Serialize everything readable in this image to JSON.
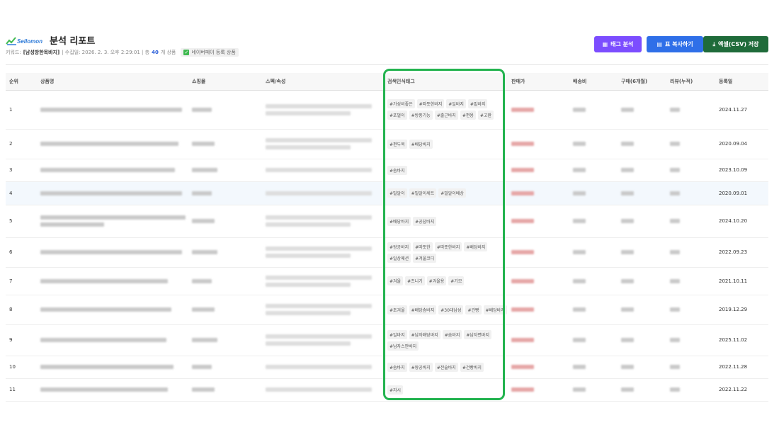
{
  "header": {
    "logo_text": "Sellomon",
    "title": "분석 리포트",
    "meta_prefix": "키워드:",
    "keyword": "[남성방한목바지]",
    "meta_collected": "| 수집일: 2026. 2. 3. 오후 2:29:01 | 총",
    "product_count": "40",
    "meta_suffix": "개 상품",
    "naverpay_badge": "네이버페이 등록 상품"
  },
  "toolbar": {
    "tag_analysis_label": "태그 분석",
    "copy_table_label": "표 복사하기",
    "excel_label": "엑셀(CSV) 저장"
  },
  "table": {
    "headers": [
      "순위",
      "상품명",
      "쇼핑몰",
      "스펙/속성",
      "검색인식태그",
      "판매가",
      "배송비",
      "구매(6개월)",
      "리뷰(누적)",
      "등록일"
    ],
    "rows": [
      {
        "rank": "1",
        "tags": [
          "#가성비좋은",
          "#따뜻한바지",
          "#일바지",
          "#밑바지",
          "#포멀이",
          "#방풍기능",
          "#출근바지",
          "#편용",
          "#고환"
        ],
        "date": "2024.11.27"
      },
      {
        "rank": "2",
        "tags": [
          "#편두복",
          "#배당바지"
        ],
        "date": "2020.09.04"
      },
      {
        "rank": "3",
        "tags": [
          "#솜바지"
        ],
        "date": "2023.10.09"
      },
      {
        "rank": "4",
        "tags": [
          "#밀알이",
          "#밀알이세트",
          "#밀알이배상"
        ],
        "date": "2020.09.01"
      },
      {
        "rank": "5",
        "tags": [
          "#배당바지",
          "#공답바지"
        ],
        "date": "2024.10.20"
      },
      {
        "rank": "6",
        "tags": [
          "#왕공바지",
          "#따뜻한",
          "#따뜻한바지",
          "#배당바지",
          "#일상패션",
          "#겨울코디"
        ],
        "date": "2022.09.23"
      },
      {
        "rank": "7",
        "tags": [
          "#겨울",
          "#츠니기",
          "#겨울용",
          "#기모"
        ],
        "date": "2021.10.11"
      },
      {
        "rank": "8",
        "tags": [
          "#초겨울",
          "#배당솜바지",
          "#30대남성",
          "#건빵",
          "#배당바지"
        ],
        "date": "2019.12.29"
      },
      {
        "rank": "9",
        "tags": [
          "#일바지",
          "#남자배당바지",
          "#솜바지",
          "#남자면바지",
          "#남자스판바지"
        ],
        "date": "2025.11.02"
      },
      {
        "rank": "10",
        "tags": [
          "#솜바지",
          "#왕공바지",
          "#전술바지",
          "#건빵바지"
        ],
        "date": "2022.11.28"
      },
      {
        "rank": "11",
        "tags": [
          "#자시"
        ],
        "date": "2022.11.22"
      }
    ]
  },
  "colors": {
    "tag_button": "#7c4dff",
    "copy_button": "#2f6fe8",
    "excel_button": "#1f6b3a",
    "highlight_border": "#23b34f",
    "count": "#2b5fd9"
  },
  "icons": {
    "tag_button": "chart-icon",
    "copy_button": "clipboard-icon",
    "excel_button": "download-icon",
    "badge": "checkbox-icon"
  }
}
